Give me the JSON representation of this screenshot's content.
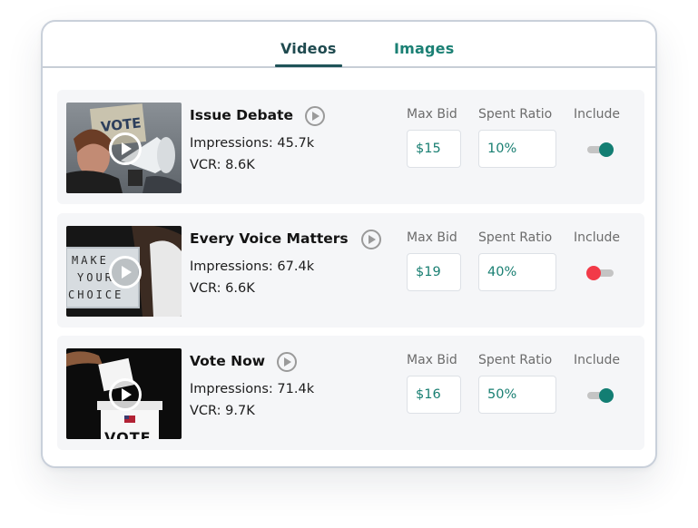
{
  "tabs": [
    {
      "label": "Videos",
      "active": true
    },
    {
      "label": "Images",
      "active": false
    }
  ],
  "columns": {
    "max_bid": "Max Bid",
    "spent_ratio": "Spent Ratio",
    "include": "Include"
  },
  "rows": [
    {
      "title": "Issue Debate",
      "impressions": "Impressions: 45.7k",
      "vcr": "VCR: 8.6K",
      "max_bid": "$15",
      "spent_ratio": "10%",
      "include": true
    },
    {
      "title": "Every Voice Matters",
      "impressions": "Impressions: 67.4k",
      "vcr": "VCR: 6.6K",
      "max_bid": "$19",
      "spent_ratio": "40%",
      "include": false
    },
    {
      "title": "Vote Now",
      "impressions": "Impressions: 71.4k",
      "vcr": "VCR: 9.7K",
      "max_bid": "$16",
      "spent_ratio": "50%",
      "include": true
    }
  ],
  "thumbnails": {
    "row1_sign": "VOTE",
    "row2_board": [
      "MAKE",
      "YOUR",
      "CHOICE"
    ],
    "row3_box": "VOTE"
  },
  "colors": {
    "accent": "#137e73",
    "tab_active": "#1f4a4f",
    "toggle_off": "#f23a48",
    "row_bg": "#f5f6f8"
  },
  "icons": [
    "play-icon",
    "toggle-switch-icon"
  ]
}
